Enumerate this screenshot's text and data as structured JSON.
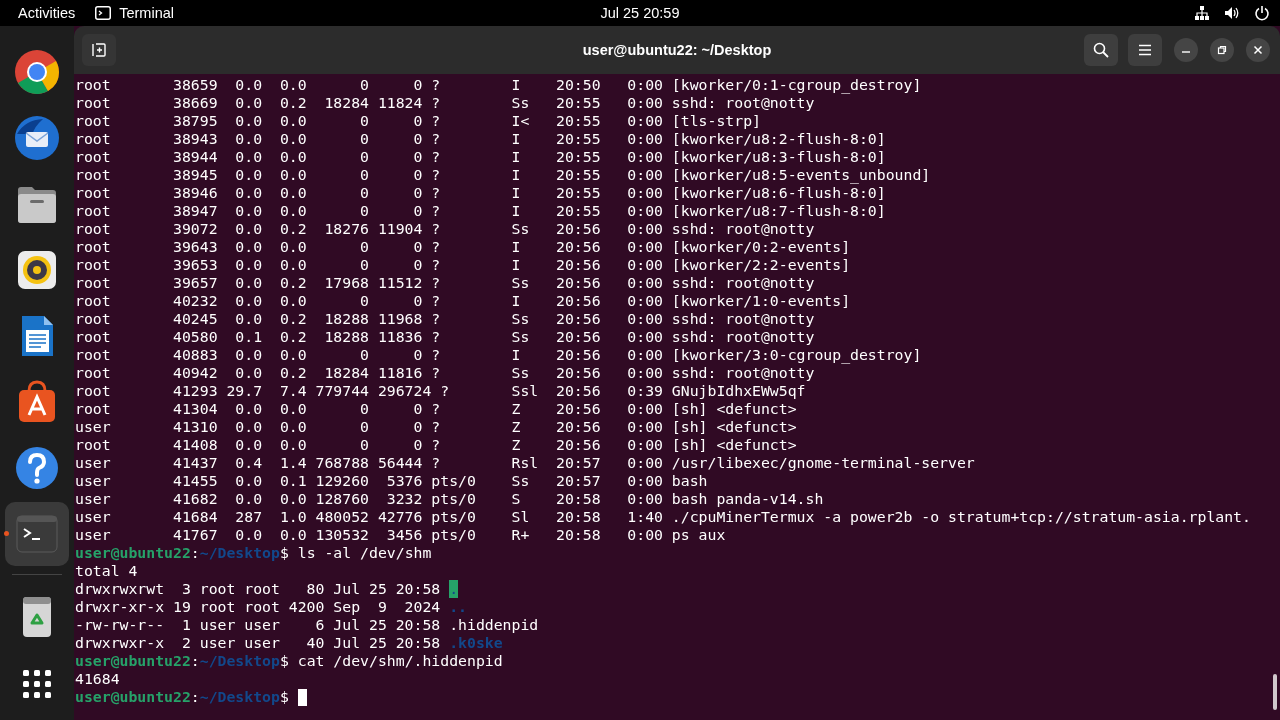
{
  "topbar": {
    "activities": "Activities",
    "app": "Terminal",
    "clock": "Jul 25  20:59"
  },
  "dock": {
    "apps": [
      {
        "kind": "browser",
        "selected": false,
        "running": false
      },
      {
        "kind": "mail",
        "selected": false,
        "running": false
      },
      {
        "kind": "files",
        "selected": false,
        "running": false
      },
      {
        "kind": "music",
        "selected": false,
        "running": false
      },
      {
        "kind": "writer",
        "selected": false,
        "running": false
      },
      {
        "kind": "software",
        "selected": false,
        "running": false
      },
      {
        "kind": "help",
        "selected": false,
        "running": false
      },
      {
        "kind": "terminal",
        "selected": true,
        "running": true
      },
      {
        "kind": "trash",
        "selected": false,
        "running": false
      }
    ]
  },
  "window": {
    "title": "user@ubuntu22: ~/Desktop"
  },
  "terminal": {
    "lines": [
      {
        "segments": [
          {
            "kind": "plain",
            "text": "root       38659  0.0  0.0      0     0 ?        I    20:50   0:00 [kworker/0:1-cgroup_destroy]"
          }
        ]
      },
      {
        "segments": [
          {
            "kind": "plain",
            "text": "root       38669  0.0  0.2  18284 11824 ?        Ss   20:55   0:00 sshd: root@notty"
          }
        ]
      },
      {
        "segments": [
          {
            "kind": "plain",
            "text": "root       38795  0.0  0.0      0     0 ?        I<   20:55   0:00 [tls-strp]"
          }
        ]
      },
      {
        "segments": [
          {
            "kind": "plain",
            "text": "root       38943  0.0  0.0      0     0 ?        I    20:55   0:00 [kworker/u8:2-flush-8:0]"
          }
        ]
      },
      {
        "segments": [
          {
            "kind": "plain",
            "text": "root       38944  0.0  0.0      0     0 ?        I    20:55   0:00 [kworker/u8:3-flush-8:0]"
          }
        ]
      },
      {
        "segments": [
          {
            "kind": "plain",
            "text": "root       38945  0.0  0.0      0     0 ?        I    20:55   0:00 [kworker/u8:5-events_unbound]"
          }
        ]
      },
      {
        "segments": [
          {
            "kind": "plain",
            "text": "root       38946  0.0  0.0      0     0 ?        I    20:55   0:00 [kworker/u8:6-flush-8:0]"
          }
        ]
      },
      {
        "segments": [
          {
            "kind": "plain",
            "text": "root       38947  0.0  0.0      0     0 ?        I    20:55   0:00 [kworker/u8:7-flush-8:0]"
          }
        ]
      },
      {
        "segments": [
          {
            "kind": "plain",
            "text": "root       39072  0.0  0.2  18276 11904 ?        Ss   20:56   0:00 sshd: root@notty"
          }
        ]
      },
      {
        "segments": [
          {
            "kind": "plain",
            "text": "root       39643  0.0  0.0      0     0 ?        I    20:56   0:00 [kworker/0:2-events]"
          }
        ]
      },
      {
        "segments": [
          {
            "kind": "plain",
            "text": "root       39653  0.0  0.0      0     0 ?        I    20:56   0:00 [kworker/2:2-events]"
          }
        ]
      },
      {
        "segments": [
          {
            "kind": "plain",
            "text": "root       39657  0.0  0.2  17968 11512 ?        Ss   20:56   0:00 sshd: root@notty"
          }
        ]
      },
      {
        "segments": [
          {
            "kind": "plain",
            "text": "root       40232  0.0  0.0      0     0 ?        I    20:56   0:00 [kworker/1:0-events]"
          }
        ]
      },
      {
        "segments": [
          {
            "kind": "plain",
            "text": "root       40245  0.0  0.2  18288 11968 ?        Ss   20:56   0:00 sshd: root@notty"
          }
        ]
      },
      {
        "segments": [
          {
            "kind": "plain",
            "text": "root       40580  0.1  0.2  18288 11836 ?        Ss   20:56   0:00 sshd: root@notty"
          }
        ]
      },
      {
        "segments": [
          {
            "kind": "plain",
            "text": "root       40883  0.0  0.0      0     0 ?        I    20:56   0:00 [kworker/3:0-cgroup_destroy]"
          }
        ]
      },
      {
        "segments": [
          {
            "kind": "plain",
            "text": "root       40942  0.0  0.2  18284 11816 ?        Ss   20:56   0:00 sshd: root@notty"
          }
        ]
      },
      {
        "segments": [
          {
            "kind": "plain",
            "text": "root       41293 29.7  7.4 779744 296724 ?       Ssl  20:56   0:39 GNujbIdhxEWw5qf"
          }
        ]
      },
      {
        "segments": [
          {
            "kind": "plain",
            "text": "root       41304  0.0  0.0      0     0 ?        Z    20:56   0:00 [sh] <defunct>"
          }
        ]
      },
      {
        "segments": [
          {
            "kind": "plain",
            "text": "user       41310  0.0  0.0      0     0 ?        Z    20:56   0:00 [sh] <defunct>"
          }
        ]
      },
      {
        "segments": [
          {
            "kind": "plain",
            "text": "root       41408  0.0  0.0      0     0 ?        Z    20:56   0:00 [sh] <defunct>"
          }
        ]
      },
      {
        "segments": [
          {
            "kind": "plain",
            "text": "user       41437  0.4  1.4 768788 56444 ?        Rsl  20:57   0:00 /usr/libexec/gnome-terminal-server"
          }
        ]
      },
      {
        "segments": [
          {
            "kind": "plain",
            "text": "user       41455  0.0  0.1 129260  5376 pts/0    Ss   20:57   0:00 bash"
          }
        ]
      },
      {
        "segments": [
          {
            "kind": "plain",
            "text": "user       41682  0.0  0.0 128760  3232 pts/0    S    20:58   0:00 bash panda-v14.sh"
          }
        ]
      },
      {
        "segments": [
          {
            "kind": "plain",
            "text": "user       41684  287  1.0 480052 42776 pts/0    Sl   20:58   1:40 ./cpuMinerTermux -a power2b -o stratum+tcp://stratum-asia.rplant."
          }
        ]
      },
      {
        "segments": [
          {
            "kind": "plain",
            "text": "user       41767  0.0  0.0 130532  3456 pts/0    R+   20:58   0:00 ps aux"
          }
        ]
      },
      {
        "segments": [
          {
            "kind": "host",
            "text": "user@ubuntu22"
          },
          {
            "kind": "plain",
            "text": ":"
          },
          {
            "kind": "path",
            "text": "~/Desktop"
          },
          {
            "kind": "plain",
            "text": "$ ls -al /dev/shm"
          }
        ]
      },
      {
        "segments": [
          {
            "kind": "plain",
            "text": "total 4"
          }
        ]
      },
      {
        "segments": [
          {
            "kind": "plain",
            "text": "drwxrwxrwt  3 root root   80 Jul 25 20:58 "
          },
          {
            "kind": "sticky",
            "text": "."
          }
        ]
      },
      {
        "segments": [
          {
            "kind": "plain",
            "text": "drwxr-xr-x 19 root root 4200 Sep  9  2024 "
          },
          {
            "kind": "dir",
            "text": ".."
          }
        ]
      },
      {
        "segments": [
          {
            "kind": "plain",
            "text": "-rw-rw-r--  1 user user    6 Jul 25 20:58 .hiddenpid"
          }
        ]
      },
      {
        "segments": [
          {
            "kind": "plain",
            "text": "drwxrwxr-x  2 user user   40 Jul 25 20:58 "
          },
          {
            "kind": "dir",
            "text": ".k0ske"
          }
        ]
      },
      {
        "segments": [
          {
            "kind": "host",
            "text": "user@ubuntu22"
          },
          {
            "kind": "plain",
            "text": ":"
          },
          {
            "kind": "path",
            "text": "~/Desktop"
          },
          {
            "kind": "plain",
            "text": "$ cat /dev/shm/.hiddenpid"
          }
        ]
      },
      {
        "segments": [
          {
            "kind": "plain",
            "text": "41684"
          }
        ]
      },
      {
        "segments": [
          {
            "kind": "host",
            "text": "user@ubuntu22"
          },
          {
            "kind": "plain",
            "text": ":"
          },
          {
            "kind": "path",
            "text": "~/Desktop"
          },
          {
            "kind": "plain",
            "text": "$ "
          }
        ],
        "cursor": true
      }
    ]
  }
}
